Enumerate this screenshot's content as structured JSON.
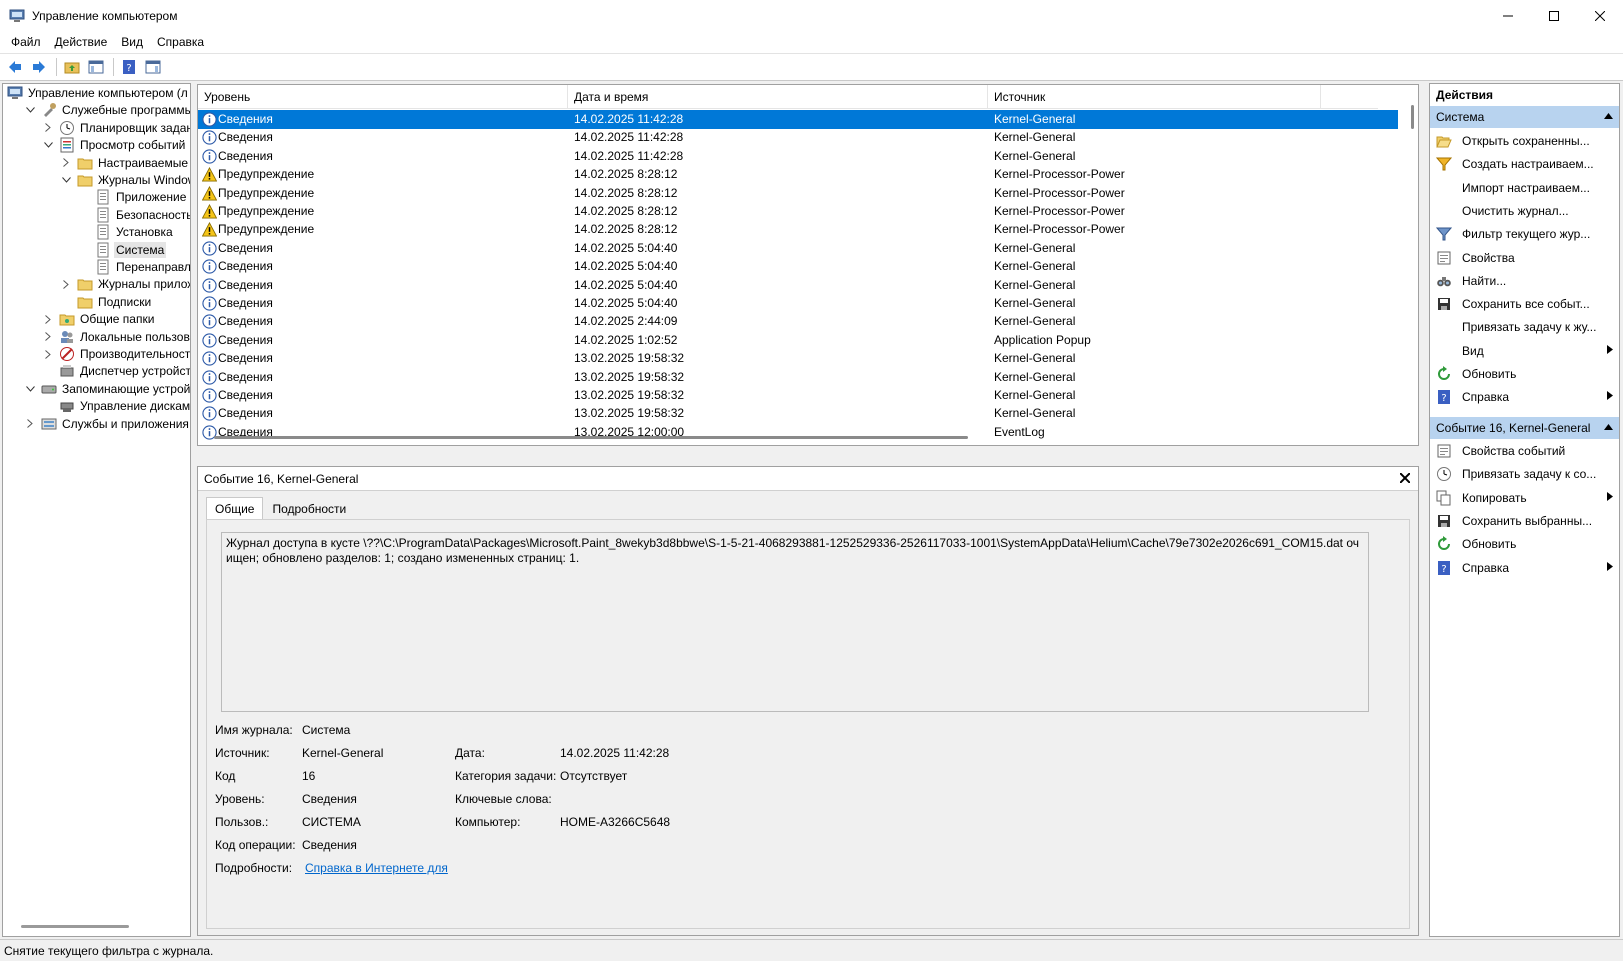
{
  "window": {
    "title": "Управление компьютером"
  },
  "menu": [
    "Файл",
    "Действие",
    "Вид",
    "Справка"
  ],
  "tree": [
    {
      "label": "Управление компьютером (л",
      "level": 0,
      "exp": "",
      "icon": "computer-management-icon"
    },
    {
      "label": "Служебные программы",
      "level": 1,
      "exp": "v",
      "icon": "tools-icon"
    },
    {
      "label": "Планировщик заданий",
      "level": 2,
      "exp": ">",
      "icon": "clock-icon"
    },
    {
      "label": "Просмотр событий",
      "level": 2,
      "exp": "v",
      "icon": "event-viewer-icon"
    },
    {
      "label": "Настраиваемые пр",
      "level": 3,
      "exp": ">",
      "icon": "folder-icon"
    },
    {
      "label": "Журналы Windows",
      "level": 3,
      "exp": "v",
      "icon": "folder-icon"
    },
    {
      "label": "Приложение",
      "level": 4,
      "exp": "",
      "icon": "log-icon"
    },
    {
      "label": "Безопасность",
      "level": 4,
      "exp": "",
      "icon": "log-icon"
    },
    {
      "label": "Установка",
      "level": 4,
      "exp": "",
      "icon": "log-icon"
    },
    {
      "label": "Система",
      "level": 4,
      "exp": "",
      "icon": "log-icon",
      "selected": true
    },
    {
      "label": "Перенаправлен",
      "level": 4,
      "exp": "",
      "icon": "log-icon"
    },
    {
      "label": "Журналы приложе",
      "level": 3,
      "exp": ">",
      "icon": "folder-icon"
    },
    {
      "label": "Подписки",
      "level": 3,
      "exp": "",
      "icon": "folder-icon"
    },
    {
      "label": "Общие папки",
      "level": 2,
      "exp": ">",
      "icon": "shared-folder-icon"
    },
    {
      "label": "Локальные пользовате",
      "level": 2,
      "exp": ">",
      "icon": "users-icon"
    },
    {
      "label": "Производительность",
      "level": 2,
      "exp": ">",
      "icon": "performance-icon"
    },
    {
      "label": "Диспетчер устройств",
      "level": 2,
      "exp": "",
      "icon": "device-manager-icon"
    },
    {
      "label": "Запоминающие устройст",
      "level": 1,
      "exp": "v",
      "icon": "storage-icon"
    },
    {
      "label": "Управление дисками",
      "level": 2,
      "exp": "",
      "icon": "disk-icon"
    },
    {
      "label": "Службы и приложения",
      "level": 1,
      "exp": ">",
      "icon": "services-icon"
    }
  ],
  "list": {
    "columns": [
      "Уровень",
      "Дата и время",
      "Источник"
    ],
    "rows": [
      {
        "level": "Сведения",
        "type": "info",
        "date": "14.02.2025 11:42:28",
        "source": "Kernel-General",
        "selected": true
      },
      {
        "level": "Сведения",
        "type": "info",
        "date": "14.02.2025 11:42:28",
        "source": "Kernel-General"
      },
      {
        "level": "Сведения",
        "type": "info",
        "date": "14.02.2025 11:42:28",
        "source": "Kernel-General"
      },
      {
        "level": "Предупреждение",
        "type": "warn",
        "date": "14.02.2025 8:28:12",
        "source": "Kernel-Processor-Power"
      },
      {
        "level": "Предупреждение",
        "type": "warn",
        "date": "14.02.2025 8:28:12",
        "source": "Kernel-Processor-Power"
      },
      {
        "level": "Предупреждение",
        "type": "warn",
        "date": "14.02.2025 8:28:12",
        "source": "Kernel-Processor-Power"
      },
      {
        "level": "Предупреждение",
        "type": "warn",
        "date": "14.02.2025 8:28:12",
        "source": "Kernel-Processor-Power"
      },
      {
        "level": "Сведения",
        "type": "info",
        "date": "14.02.2025 5:04:40",
        "source": "Kernel-General"
      },
      {
        "level": "Сведения",
        "type": "info",
        "date": "14.02.2025 5:04:40",
        "source": "Kernel-General"
      },
      {
        "level": "Сведения",
        "type": "info",
        "date": "14.02.2025 5:04:40",
        "source": "Kernel-General"
      },
      {
        "level": "Сведения",
        "type": "info",
        "date": "14.02.2025 5:04:40",
        "source": "Kernel-General"
      },
      {
        "level": "Сведения",
        "type": "info",
        "date": "14.02.2025 2:44:09",
        "source": "Kernel-General"
      },
      {
        "level": "Сведения",
        "type": "info",
        "date": "14.02.2025 1:02:52",
        "source": "Application Popup"
      },
      {
        "level": "Сведения",
        "type": "info",
        "date": "13.02.2025 19:58:32",
        "source": "Kernel-General"
      },
      {
        "level": "Сведения",
        "type": "info",
        "date": "13.02.2025 19:58:32",
        "source": "Kernel-General"
      },
      {
        "level": "Сведения",
        "type": "info",
        "date": "13.02.2025 19:58:32",
        "source": "Kernel-General"
      },
      {
        "level": "Сведения",
        "type": "info",
        "date": "13.02.2025 19:58:32",
        "source": "Kernel-General"
      },
      {
        "level": "Сведения",
        "type": "info",
        "date": "13.02.2025 12:00:00",
        "source": "EventLog"
      }
    ]
  },
  "detail": {
    "header": "Событие 16, Kernel-General",
    "tabs": [
      "Общие",
      "Подробности"
    ],
    "message": "Журнал доступа в кусте \\??\\C:\\ProgramData\\Packages\\Microsoft.Paint_8wekyb3d8bbwe\\S-1-5-21-4068293881-1252529336-2526117033-1001\\SystemAppData\\Helium\\Cache\\79e7302e2026c691_COM15.dat очищен; обновлено разделов: 1; создано измененных страниц: 1.",
    "fields": {
      "log_name_label": "Имя журнала:",
      "log_name": "Система",
      "source_label": "Источник:",
      "source": "Kernel-General",
      "date_label": "Дата:",
      "date": "14.02.2025 11:42:28",
      "code_label": "Код",
      "code": "16",
      "task_label": "Категория задачи:",
      "task": "Отсутствует",
      "level_label": "Уровень:",
      "level": "Сведения",
      "keywords_label": "Ключевые слова:",
      "user_label": "Пользов.:",
      "user": "СИСТЕМА",
      "computer_label": "Компьютер:",
      "computer": "HOME-A3266C5648",
      "opcode_label": "Код операции:",
      "opcode": "Сведения",
      "more_label": "Подробности:",
      "more_link": "Справка в Интернете для"
    }
  },
  "actions": {
    "title": "Действия",
    "section1": "Система",
    "items1": [
      {
        "label": "Открыть сохраненны...",
        "icon": "open-folder-icon"
      },
      {
        "label": "Создать настраиваем...",
        "icon": "filter-create-icon"
      },
      {
        "label": "Импорт настраиваем...",
        "icon": ""
      },
      {
        "label": "Очистить журнал...",
        "icon": ""
      },
      {
        "label": "Фильтр текущего жур...",
        "icon": "filter-icon"
      },
      {
        "label": "Свойства",
        "icon": "properties-icon"
      },
      {
        "label": "Найти...",
        "icon": "binoculars-icon"
      },
      {
        "label": "Сохранить все событ...",
        "icon": "save-icon"
      },
      {
        "label": "Привязать задачу к жу...",
        "icon": ""
      },
      {
        "label": "Вид",
        "icon": "",
        "submenu": true
      },
      {
        "label": "Обновить",
        "icon": "refresh-icon"
      },
      {
        "label": "Справка",
        "icon": "help-icon",
        "submenu": true
      }
    ],
    "section2": "Событие 16, Kernel-General",
    "items2": [
      {
        "label": "Свойства событий",
        "icon": "properties-icon"
      },
      {
        "label": "Привязать задачу к со...",
        "icon": "task-icon"
      },
      {
        "label": "Копировать",
        "icon": "copy-icon",
        "submenu": true
      },
      {
        "label": "Сохранить выбранны...",
        "icon": "save-icon"
      },
      {
        "label": "Обновить",
        "icon": "refresh-icon"
      },
      {
        "label": "Справка",
        "icon": "help-icon",
        "submenu": true
      }
    ]
  },
  "status": "Снятие текущего фильтра с журнала.",
  "colors": {
    "selection": "#0078d7",
    "section": "#b8d3ef",
    "link": "#0066cc"
  }
}
